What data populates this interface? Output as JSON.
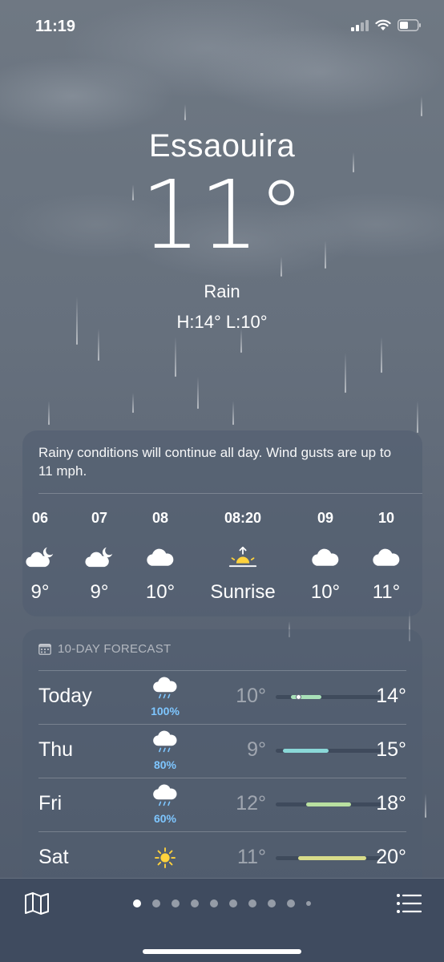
{
  "status_bar": {
    "time": "11:19"
  },
  "location": {
    "city": "Essaouira",
    "temperature": "11°",
    "condition": "Rain",
    "high_low": "H:14°  L:10°"
  },
  "hourly": {
    "summary": "Rainy conditions will continue all day. Wind gusts are up to 11 mph.",
    "items": [
      {
        "time": "06",
        "icon": "cloud-moon-icon",
        "temp": "9°"
      },
      {
        "time": "07",
        "icon": "cloud-moon-icon",
        "temp": "9°"
      },
      {
        "time": "08",
        "icon": "cloud-icon",
        "temp": "10°"
      },
      {
        "time": "08:20",
        "icon": "sunrise-icon",
        "temp": "Sunrise"
      },
      {
        "time": "09",
        "icon": "cloud-icon",
        "temp": "10°"
      },
      {
        "time": "10",
        "icon": "cloud-icon",
        "temp": "11°"
      }
    ]
  },
  "forecast": {
    "header": "10-DAY FORECAST",
    "range_scale": {
      "min": 8,
      "max": 22
    },
    "days": [
      {
        "day": "Today",
        "icon": "cloud-rain-icon",
        "precip": "100%",
        "low": "10°",
        "high": "14°",
        "low_value": 10,
        "high_value": 14,
        "current_value": 11,
        "color": "#a8e0b8"
      },
      {
        "day": "Thu",
        "icon": "cloud-rain-icon",
        "precip": "80%",
        "low": "9°",
        "high": "15°",
        "low_value": 9,
        "high_value": 15,
        "color": "#8ad8d8"
      },
      {
        "day": "Fri",
        "icon": "cloud-rain-icon",
        "precip": "60%",
        "low": "12°",
        "high": "18°",
        "low_value": 12,
        "high_value": 18,
        "color": "#b9e0a0"
      },
      {
        "day": "Sat",
        "icon": "sun-icon",
        "precip": "",
        "low": "11°",
        "high": "20°",
        "low_value": 11,
        "high_value": 20,
        "color": "#d8dc8a"
      }
    ]
  },
  "pager": {
    "count": 10,
    "active": 0
  },
  "colors": {
    "accent_precip": "#7ec6ff",
    "sun": "#ffd23c"
  }
}
